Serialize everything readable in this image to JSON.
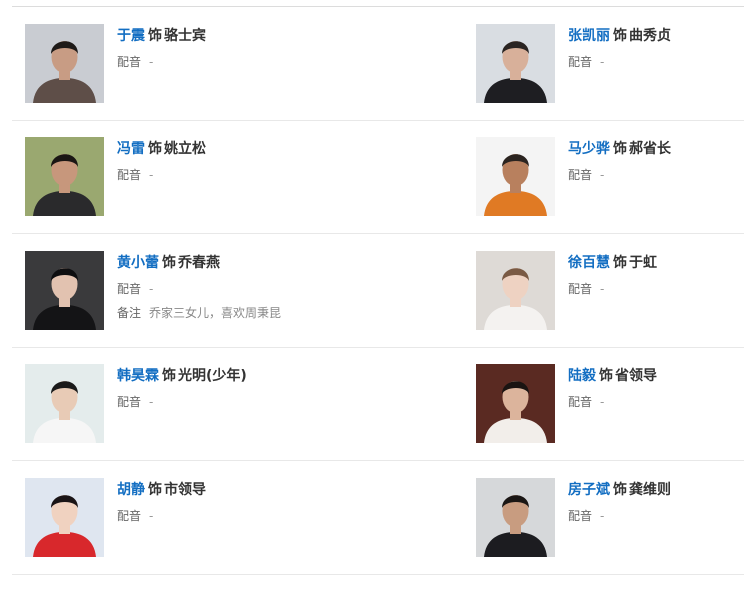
{
  "role_word": "饰",
  "dub_label": "配音",
  "dub_value": "-",
  "note_label": "备注",
  "cast": [
    {
      "actor": "于震",
      "role": "骆士宾",
      "photo_icon": "actor-portrait",
      "bg": "#c9ccd2",
      "skin": "#c89c84",
      "hair": "#1e1a18",
      "cloth": "#5e4e48"
    },
    {
      "actor": "张凯丽",
      "role": "曲秀贞",
      "photo_icon": "actor-portrait",
      "bg": "#d9dde2",
      "skin": "#d8b09a",
      "hair": "#2a2422",
      "cloth": "#1e1e22"
    },
    {
      "actor": "冯雷",
      "role": "姚立松",
      "photo_icon": "actor-portrait",
      "bg": "#9aa870",
      "skin": "#c7977c",
      "hair": "#1a1614",
      "cloth": "#2a2a2c"
    },
    {
      "actor": "马少骅",
      "role": "郝省长",
      "photo_icon": "actor-portrait",
      "bg": "#f4f4f4",
      "skin": "#b8805e",
      "hair": "#2b2420",
      "cloth": "#e07a24"
    },
    {
      "actor": "黄小蕾",
      "role": "乔春燕",
      "photo_icon": "actor-portrait",
      "bg": "#3a3a3c",
      "skin": "#e2c2b0",
      "hair": "#0e0e10",
      "cloth": "#141416",
      "note": "乔家三女儿，喜欢周秉昆"
    },
    {
      "actor": "徐百慧",
      "role": "于虹",
      "photo_icon": "actor-portrait",
      "bg": "#dedad6",
      "skin": "#eed2c2",
      "hair": "#7a5a44",
      "cloth": "#f4f2f0"
    },
    {
      "actor": "韩昊霖",
      "role": "光明(少年)",
      "photo_icon": "actor-portrait",
      "bg": "#e4ecec",
      "skin": "#e8cbb6",
      "hair": "#1a1a1a",
      "cloth": "#f6f6f6"
    },
    {
      "actor": "陆毅",
      "role": "省领导",
      "photo_icon": "actor-portrait",
      "bg": "#5a2a22",
      "skin": "#dcb49c",
      "hair": "#1a1412",
      "cloth": "#f2eeea"
    },
    {
      "actor": "胡静",
      "role": "市领导",
      "photo_icon": "actor-portrait",
      "bg": "#dfe6f0",
      "skin": "#f0d2c0",
      "hair": "#1a1416",
      "cloth": "#d8282c"
    },
    {
      "actor": "房子斌",
      "role": "龚维则",
      "photo_icon": "actor-portrait",
      "bg": "#d6d8da",
      "skin": "#c89c80",
      "hair": "#1a1614",
      "cloth": "#1c1c20"
    }
  ]
}
